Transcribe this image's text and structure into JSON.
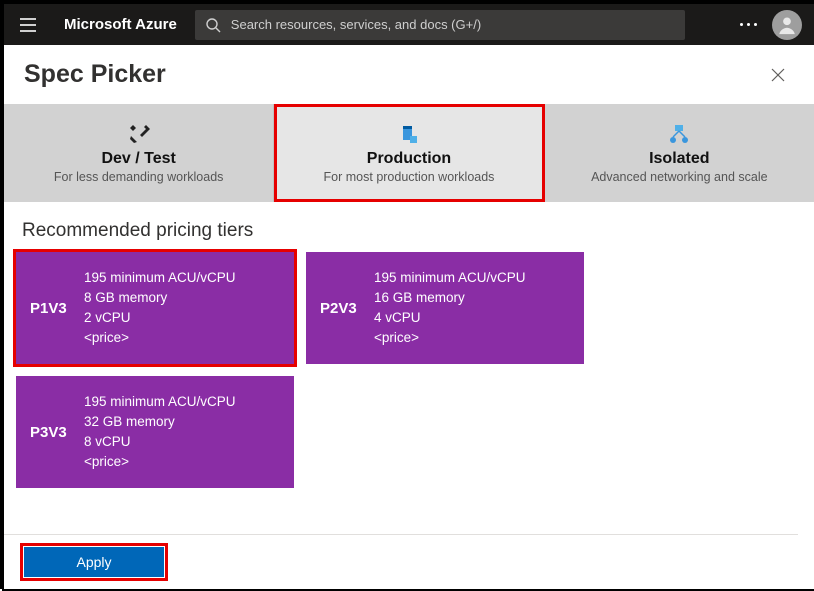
{
  "nav": {
    "brand": "Microsoft Azure",
    "search_placeholder": "Search resources, services, and docs (G+/)"
  },
  "page": {
    "title": "Spec Picker"
  },
  "tabs": [
    {
      "id": "devtest",
      "label": "Dev / Test",
      "desc": "For less demanding workloads",
      "selected": false
    },
    {
      "id": "production",
      "label": "Production",
      "desc": "For most production workloads",
      "selected": true
    },
    {
      "id": "isolated",
      "label": "Isolated",
      "desc": "Advanced networking and scale",
      "selected": false
    }
  ],
  "section_title": "Recommended pricing tiers",
  "tiers": [
    {
      "sku": "P1V3",
      "acu": "195 minimum ACU/vCPU",
      "memory": "8 GB memory",
      "vcpu": "2 vCPU",
      "price": "<price>",
      "selected": true
    },
    {
      "sku": "P2V3",
      "acu": "195 minimum ACU/vCPU",
      "memory": "16 GB memory",
      "vcpu": "4 vCPU",
      "price": "<price>",
      "selected": false
    },
    {
      "sku": "P3V3",
      "acu": "195 minimum ACU/vCPU",
      "memory": "32 GB memory",
      "vcpu": "8 vCPU",
      "price": "<price>",
      "selected": false
    }
  ],
  "footer": {
    "apply_label": "Apply"
  },
  "colors": {
    "tier_bg": "#8a2da5",
    "accent": "#0067b8",
    "highlight": "#e60000"
  }
}
